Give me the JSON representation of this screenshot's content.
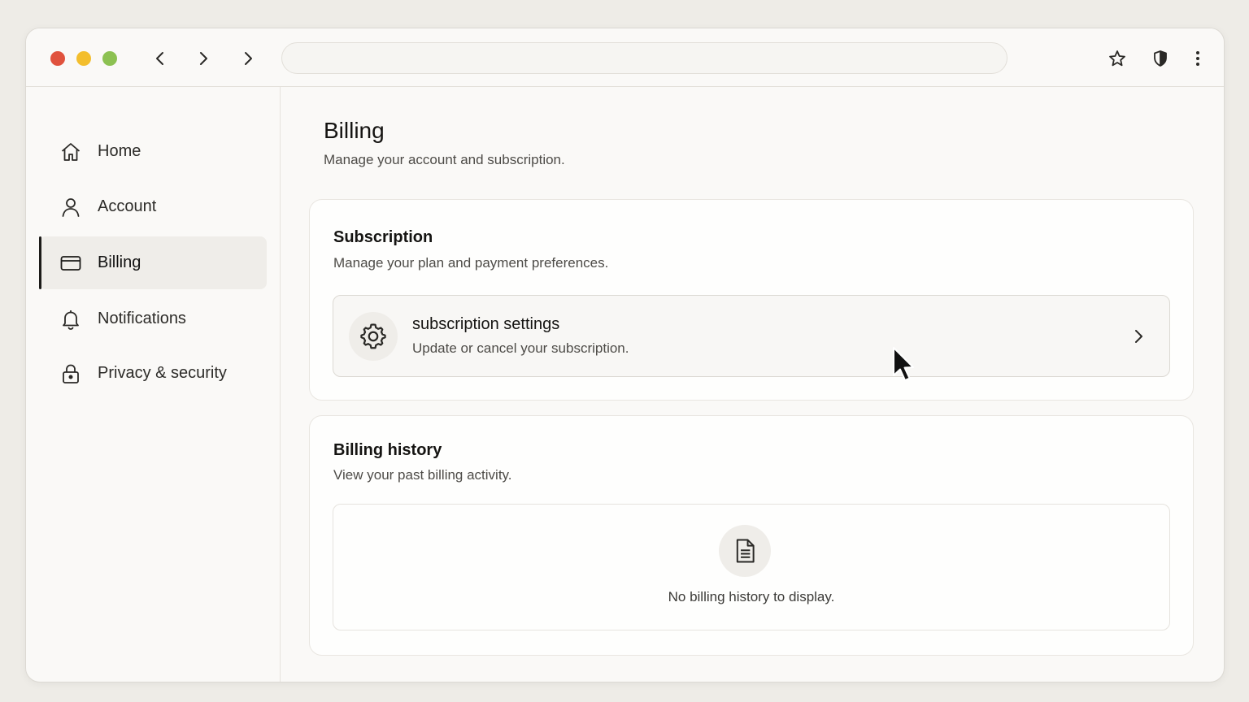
{
  "browser": {
    "url_value": "",
    "icons": {
      "back": "chevron-left-icon",
      "forward": "chevron-right-icon",
      "forward_alt": "chevron-right-icon",
      "bookmark": "star-icon",
      "shield": "shield-icon",
      "menu": "vertical-dots-icon"
    },
    "traffic_lights": [
      "#e0523d",
      "#f3be2d",
      "#8cc152"
    ]
  },
  "sidebar": {
    "items": [
      {
        "label": "Home",
        "icon": "home-icon",
        "active": false
      },
      {
        "label": "Account",
        "icon": "user-icon",
        "active": false
      },
      {
        "label": "Billing",
        "icon": "credit-card-icon",
        "active": true
      },
      {
        "label": "Notifications",
        "icon": "bell-icon",
        "active": false
      },
      {
        "label": "Privacy & security",
        "icon": "lock-icon",
        "active": false
      }
    ]
  },
  "main": {
    "title": "Billing",
    "subtitle": "Manage your account and subscription.",
    "subscription": {
      "title": "Subscription",
      "subtitle": "Manage your plan and payment preferences.",
      "settings_row": {
        "title": "subscription settings",
        "subtitle": "Update or cancel your subscription.",
        "icon": "gear-icon"
      }
    },
    "history": {
      "title": "Billing history",
      "subtitle": "View your past billing activity.",
      "empty_text": "No billing history to display.",
      "icon": "document-icon"
    }
  },
  "colors": {
    "accent": "#1c1b19",
    "background": "#eeece7",
    "active_bg": "#efede9"
  }
}
